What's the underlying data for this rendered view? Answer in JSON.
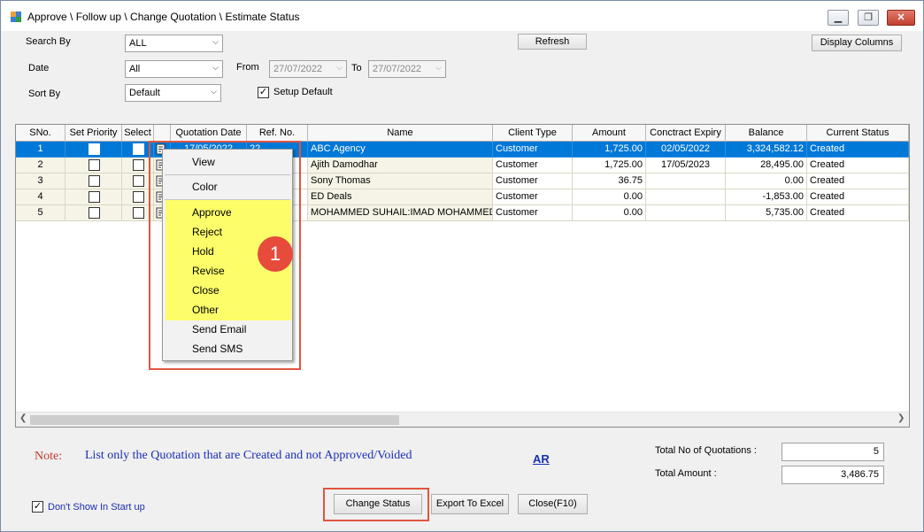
{
  "window": {
    "title": "Approve \\ Follow up \\ Change Quotation \\ Estimate Status",
    "minimize": "▁",
    "restore": "❐",
    "close": "✕"
  },
  "filters": {
    "search_by_label": "Search By",
    "search_by_value": "ALL",
    "date_label": "Date",
    "date_value": "All",
    "from_label": "From",
    "from_value": "27/07/2022",
    "to_label": "To",
    "to_value": "27/07/2022",
    "sort_by_label": "Sort By",
    "sort_by_value": "Default",
    "setup_default_label": "Setup Default",
    "setup_default_checked": true
  },
  "toolbar": {
    "refresh_label": "Refresh",
    "display_columns_label": "Display Columns"
  },
  "grid": {
    "columns": [
      "SNo.",
      "Set Priority",
      "Select",
      "",
      "Quotation Date",
      "Ref. No.",
      "Name",
      "Client Type",
      "Amount",
      "Conctract Expiry",
      "Balance",
      "Current Status"
    ],
    "rows": [
      {
        "sno": "1",
        "date": "17/05/2022",
        "ref": "22",
        "name": "ABC Agency",
        "client_type": "Customer",
        "amount": "1,725.00",
        "expiry": "02/05/2022",
        "balance": "3,324,582.12",
        "status": "Created"
      },
      {
        "sno": "2",
        "date": "",
        "ref": "",
        "name": "Ajith Damodhar",
        "client_type": "Customer",
        "amount": "1,725.00",
        "expiry": "17/05/2023",
        "balance": "28,495.00",
        "status": "Created"
      },
      {
        "sno": "3",
        "date": "",
        "ref": "",
        "name": "Sony Thomas",
        "client_type": "Customer",
        "amount": "36.75",
        "expiry": "",
        "balance": "0.00",
        "status": "Created"
      },
      {
        "sno": "4",
        "date": "",
        "ref": "",
        "name": "ED Deals",
        "client_type": "Customer",
        "amount": "0.00",
        "expiry": "",
        "balance": "-1,853.00",
        "status": "Created"
      },
      {
        "sno": "5",
        "date": "",
        "ref": "",
        "name": "MOHAMMED  SUHAIL:IMAD MOHAMMED",
        "client_type": "Customer",
        "amount": "0.00",
        "expiry": "",
        "balance": "5,735.00",
        "status": "Created"
      }
    ]
  },
  "context_menu": {
    "items": [
      "View",
      "Color",
      "Approve",
      "Reject",
      "Hold",
      "Revise",
      "Close",
      "Other",
      "Send Email",
      "Send SMS"
    ],
    "highlight_color": "#ffff52",
    "callout_color": "#e64b3c",
    "callout_number": "1"
  },
  "footer": {
    "note_label": "Note:",
    "note_text": "List only the Quotation that are Created and not Approved/Voided",
    "ar_link": "AR",
    "total_quotations_label": "Total No of Quotations :",
    "total_quotations_value": "5",
    "total_amount_label": "Total Amount :",
    "total_amount_value": "3,486.75",
    "dont_show_label": "Don't Show In Start up",
    "dont_show_checked": true,
    "change_status_label": "Change Status",
    "export_label": "Export To Excel",
    "close_label": "Close(F10)"
  },
  "colors": {
    "selection": "#0078d7",
    "row_background": "#f5f4e6",
    "link_blue": "#1a2fb5",
    "note_red": "#c0392b"
  }
}
